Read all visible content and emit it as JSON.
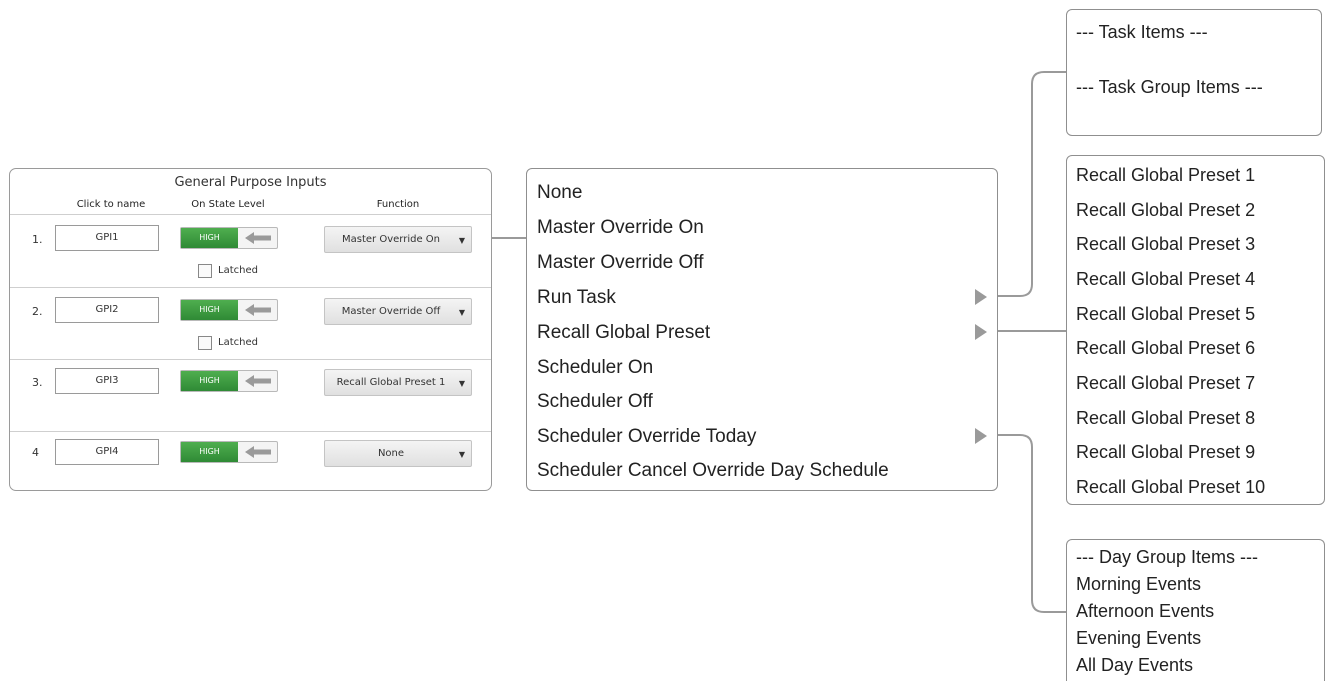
{
  "gpi_panel": {
    "title": "General Purpose Inputs",
    "headers": {
      "name": "Click to name",
      "level": "On State Level",
      "function": "Function"
    },
    "rows": [
      {
        "num": "1.",
        "name": "GPI1",
        "level": "HIGH",
        "function": "Master Override On",
        "latched_label": "Latched"
      },
      {
        "num": "2.",
        "name": "GPI2",
        "level": "HIGH",
        "function": "Master Override Off",
        "latched_label": "Latched"
      },
      {
        "num": "3.",
        "name": "GPI3",
        "level": "HIGH",
        "function": "Recall Global Preset 1"
      },
      {
        "num": "4",
        "name": "GPI4",
        "level": "HIGH",
        "function": "None"
      }
    ]
  },
  "function_menu": [
    "None",
    "Master Override On",
    "Master Override Off",
    "Run Task",
    "Recall Global Preset",
    "Scheduler On",
    "Scheduler Off",
    "Scheduler Override Today",
    "Scheduler Cancel Override Day Schedule"
  ],
  "task_submenu": [
    "--- Task Items ---",
    "--- Task Group Items ---"
  ],
  "preset_submenu": [
    "Recall Global Preset 1",
    "Recall Global Preset 2",
    "Recall Global Preset 3",
    "Recall Global Preset 4",
    "Recall Global Preset 5",
    "Recall Global Preset 6",
    "Recall Global Preset 7",
    "Recall Global Preset 8",
    "Recall Global Preset 9",
    "Recall Global Preset 10"
  ],
  "day_submenu": [
    "--- Day Group Items ---",
    "Morning Events",
    "Afternoon Events",
    "Evening Events",
    "All Day Events"
  ],
  "colors": {
    "toggle_green": "#3a9a3f",
    "border": "#8f8f8f",
    "connector": "#9a9a9a"
  },
  "icons": {
    "toggle_arrow": "left-arrow-icon",
    "dropdown_caret": "caret-down-icon",
    "submenu_arrow": "chevron-right-icon"
  }
}
